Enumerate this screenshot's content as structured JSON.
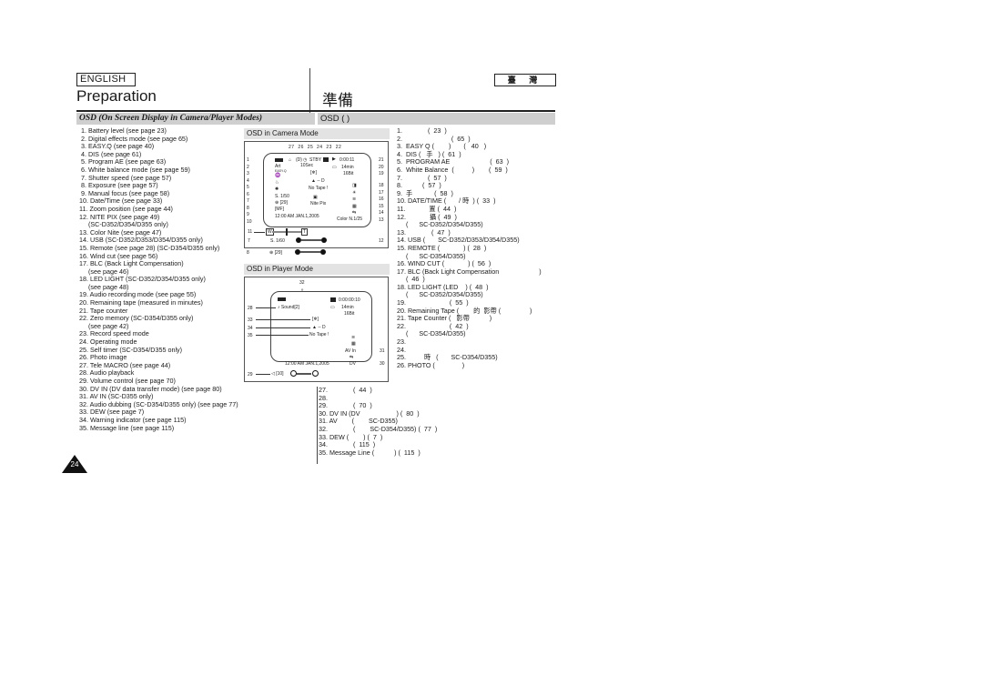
{
  "header": {
    "language_left": "ENGLISH",
    "language_right": "臺 灣",
    "title_left": "Preparation",
    "title_right": "準備"
  },
  "section": {
    "title_left": "OSD (On Screen Display in Camera/Player Modes)",
    "title_right": "OSD (                                                  )"
  },
  "english_list": [
    " 1. Battery level (see page 23)",
    " 2. Digital effects mode (see page 65)",
    " 3. EASY.Q (see page 40)",
    " 4. DIS (see page 61)",
    " 5. Program AE (see page 63)",
    " 6. White balance mode (see page 59)",
    " 7. Shutter speed (see page 57)",
    " 8. Exposure (see page 57)",
    " 9. Manual focus (see page 58)",
    "10. Date/Time (see page 33)",
    "11. Zoom position (see page 44)",
    "12. NITE PIX (see page 49)",
    "     (SC-D352/D354/D355 only)",
    "13. Color Nite (see page 47)",
    "14. USB (SC-D352/D353/D354/D355 only)",
    "15. Remote (see page 28) (SC-D354/D355 only)",
    "16. Wind cut (see page 56)",
    "17. BLC (Back Light Compensation)",
    "     (see page 46)",
    "18. LED LIGHT (SC-D352/D354/D355 only)",
    "     (see page 48)",
    "19. Audio recording mode (see page 55)",
    "20. Remaining tape (measured in minutes)",
    "21. Tape counter",
    "22. Zero memory (SC-D354/D355 only)",
    "     (see page 42)",
    "23. Record speed mode",
    "24. Operating mode",
    "25. Self timer (SC-D354/D355 only)",
    "26. Photo image",
    "27. Tele MACRO (see page 44)",
    "28. Audio playback",
    "29. Volume control (see page 70)",
    "30. DV IN (DV data transfer mode) (see page 80)",
    "31. AV IN (SC-D355 only)",
    "32. Audio dubbing (SC-D354/D355 only) (see page 77)",
    "33. DEW (see page 7)",
    "34. Warning indicator (see page 115)",
    "35. Message line (see page 115)"
  ],
  "chinese_list_a": [
    "1.              (  23  )",
    "2.                           (  65  )",
    "3.  EASY Q (        )       (   40   )",
    "4.  DIS (   手   ) (  61  )",
    "5.  PROGRAM AE                      (  63  )",
    "6.  White Balance  (          )        (  59  )",
    "7.              (  57  )",
    "8.           (  57  )",
    "9.  手            (  58  )",
    "10. DATE/TIME (       / 時  ) (  33  )",
    "11.             置 (  44  )",
    "12.             攝 (  49  )",
    "     (      SC-D352/D354/D355)",
    "13.              (  47  )",
    "14. USB (       SC-D352/D353/D354/D355)",
    "15. REMOTE (             ) (  28  )",
    "     (      SC-D354/D355)",
    "16. WIND CUT (             ) (  56  )",
    "17. BLC (Back Light Compensation                      )",
    "     (  46  )",
    "18. LED LIGHT (LED    ) (  48  )",
    "     (      SC-D352/D354/D355)",
    "19.                        (  55  )",
    "20. Remaining Tape (        的  影帶 (                )",
    "21. Tape Counter (   影帶           )",
    "22.                        (  42  )",
    "     (      SC-D354/D355)",
    "23.",
    "24.",
    "25.          時   (       SC-D354/D355)",
    "26. PHOTO (               )"
  ],
  "chinese_list_b": [
    "27.              (  44  )",
    "28.",
    "29.              (  70  )",
    "30. DV IN (DV                    ) (  80  )",
    "31. AV        (        SC-D355)",
    "32.              (        SC-D354/D355) (  77  )",
    "33. DEW (        ) (  7  )",
    "34.              (  115  )",
    "35. Message Line (           ) (  115  )"
  ],
  "camera_osd": {
    "title": "OSD in Camera Mode",
    "top_callouts": [
      "27",
      "26",
      "25",
      "24",
      "23",
      "22"
    ],
    "left_callouts": [
      "1",
      "2",
      "3",
      "4",
      "5",
      "6",
      "7",
      "8",
      "9",
      "10"
    ],
    "right_callouts": [
      "21",
      "20",
      "19",
      "18",
      "17",
      "16",
      "15",
      "14",
      "13"
    ],
    "left_texts": [
      "",
      "Art",
      "EASY.Q",
      "",
      "",
      "",
      "S. 1/50",
      "[29]",
      "",
      "12:00 AM JAN.1,2005"
    ],
    "self_timer": "10Sec",
    "mode": "STBY",
    "counter": "0:00:11",
    "remaining": "14min",
    "audio": "16Bit",
    "dew_warning": "▲ -- D",
    "message": "No Tape !",
    "nite_pix": "Nite Pix",
    "color_nite": "Color N.1/25",
    "zoom_w": "W",
    "zoom_t": "T",
    "zoom_callout": "11",
    "nite_callout": "12",
    "shutter_bar_callout": "7",
    "shutter_bar_label": "S. 1/60",
    "exposure_bar_callout": "8",
    "exposure_bar_label": "[29]"
  },
  "player_osd": {
    "title": "OSD in Player Mode",
    "dub_callout": "32",
    "left_callouts": [
      "28",
      "33",
      "34",
      "35"
    ],
    "right_callouts": [
      "31",
      "30"
    ],
    "sound": "Sound[2]",
    "counter": "0:00:00:10",
    "remaining": "14min",
    "audio": "16Bit",
    "dew_warning": "▲ -- D",
    "message": "No Tape !",
    "av_in": "AV In",
    "datetime": "12:00 AM JAN.1,2005",
    "volume_callout": "29",
    "volume_label": "[10]"
  },
  "page_number": "24"
}
